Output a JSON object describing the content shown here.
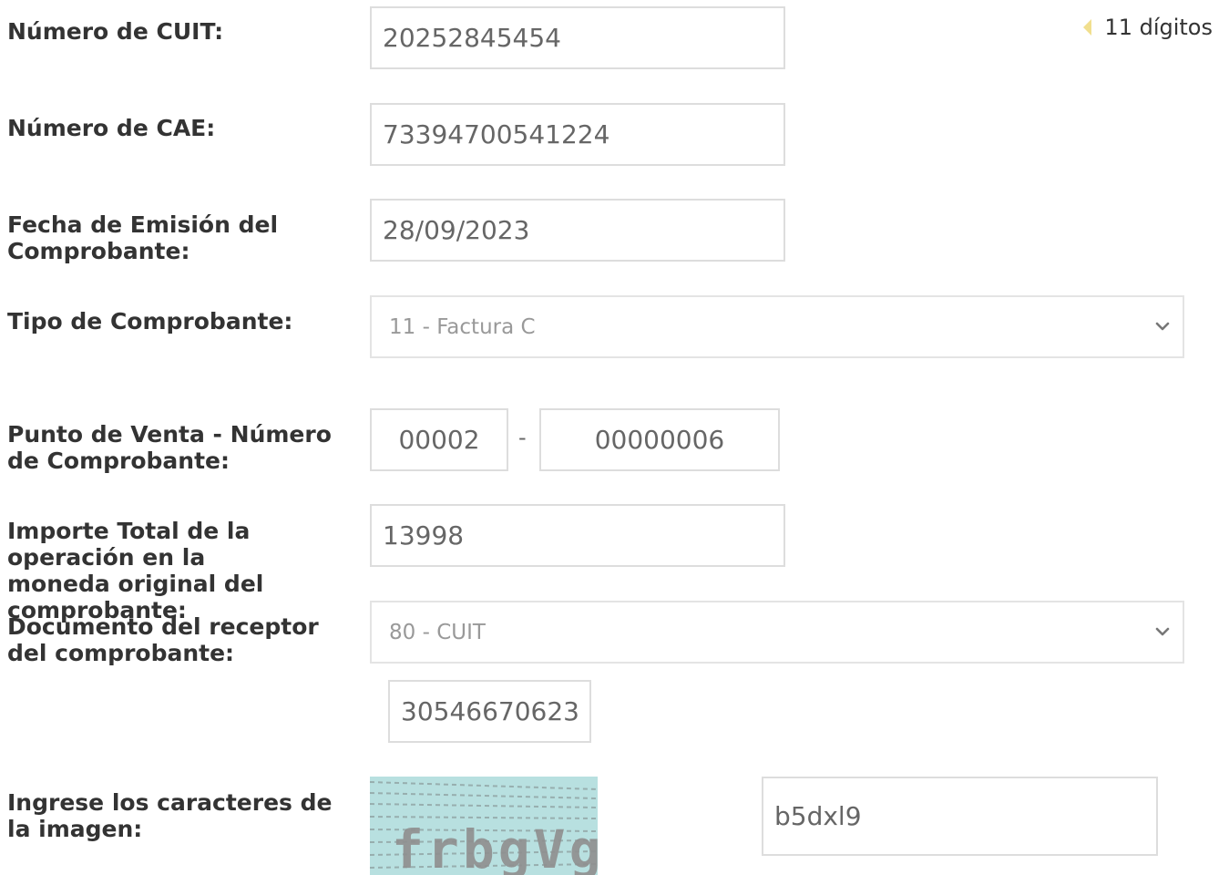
{
  "form": {
    "cuit": {
      "label": "Número de CUIT:",
      "value": "20252845454",
      "hint": "11 dígitos"
    },
    "cae": {
      "label": "Número de CAE:",
      "value": "73394700541224"
    },
    "fecha": {
      "label": "Fecha de Emisión del Comprobante:",
      "value": "28/09/2023"
    },
    "tipo": {
      "label": "Tipo de Comprobante:",
      "selected": "11 - Factura C"
    },
    "punto_venta": {
      "label": "Punto de Venta - Número de Comprobante:",
      "punto": "00002",
      "separator": "-",
      "numero": "00000006"
    },
    "importe": {
      "label": "Importe Total de la operación en la moneda original del comprobante:",
      "value": "13998"
    },
    "documento": {
      "label": "Documento del receptor del comprobante:",
      "selected": "80 - CUIT",
      "numero": "30546670623"
    },
    "captcha": {
      "label": "Ingrese los caracteres de la imagen:",
      "image_text": "frbgVg",
      "value": "b5dxl9"
    }
  },
  "colors": {
    "border": "#dddddd",
    "hint_arrow": "#f1df8e",
    "captcha_bg": "#b8e0e0"
  }
}
